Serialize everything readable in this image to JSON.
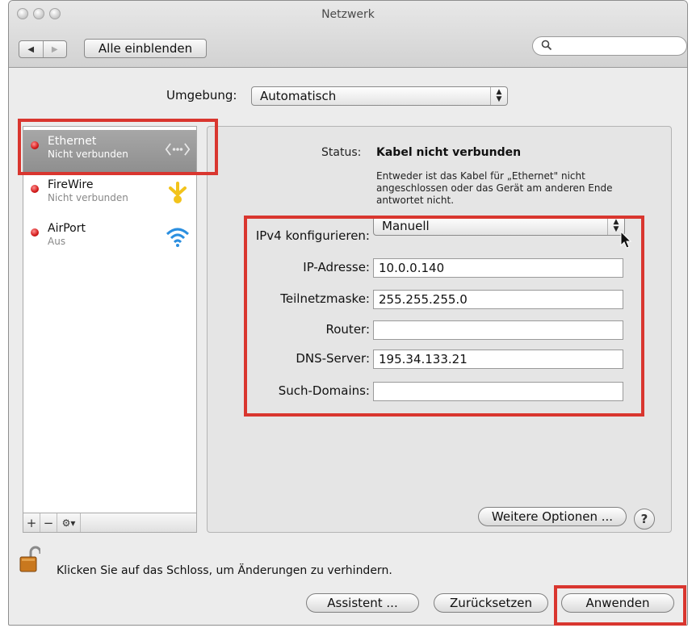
{
  "window": {
    "title": "Netzwerk"
  },
  "toolbar": {
    "back_glyph": "◀",
    "forward_glyph": "▶",
    "show_all_label": "Alle einblenden",
    "search_placeholder": ""
  },
  "location": {
    "label": "Umgebung:",
    "value": "Automatisch"
  },
  "services": [
    {
      "name": "Ethernet",
      "status": "Nicht verbunden",
      "icon": "ethernet-icon",
      "selected": true
    },
    {
      "name": "FireWire",
      "status": "Nicht verbunden",
      "icon": "firewire-icon",
      "selected": false
    },
    {
      "name": "AirPort",
      "status": "Aus",
      "icon": "airport-icon",
      "selected": false
    }
  ],
  "sidebar_buttons": {
    "add": "+",
    "remove": "−",
    "action": "⚙▾"
  },
  "status": {
    "label": "Status:",
    "value": "Kabel nicht verbunden",
    "description": "Entweder ist das Kabel für „Ethernet\" nicht angeschlossen oder das Gerät am anderen Ende antwortet nicht."
  },
  "form": {
    "ipv4_label": "IPv4 konfigurieren:",
    "ipv4_value": "Manuell",
    "ip_label": "IP-Adresse:",
    "ip_value": "10.0.0.140",
    "subnet_label": "Teilnetzmaske:",
    "subnet_value": "255.255.255.0",
    "router_label": "Router:",
    "router_value": "",
    "dns_label": "DNS-Server:",
    "dns_value": "195.34.133.21",
    "search_domains_label": "Such-Domains:",
    "search_domains_value": ""
  },
  "buttons": {
    "advanced": "Weitere Optionen ...",
    "help": "?",
    "assistant": "Assistent ...",
    "revert": "Zurücksetzen",
    "apply": "Anwenden"
  },
  "lock_text": "Klicken Sie auf das Schloss, um Änderungen zu verhindern.",
  "colors": {
    "highlight_border": "#d9362f",
    "status_dot": "#d21a1a",
    "airport_blue": "#2b8fe0",
    "firewire_yellow": "#f2c31b"
  }
}
